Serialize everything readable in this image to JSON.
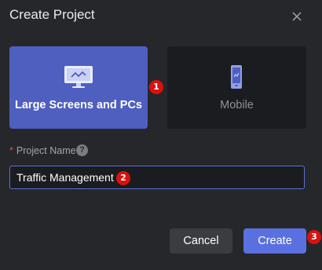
{
  "dialog": {
    "title": "Create Project",
    "close_icon": "close-icon"
  },
  "platform_options": [
    {
      "label": "Large Screens and PCs",
      "icon": "monitor-icon",
      "selected": true
    },
    {
      "label": "Mobile",
      "icon": "phone-icon",
      "selected": false
    }
  ],
  "form": {
    "required_mark": "*",
    "project_name_label": "Project Name",
    "help_icon": "question-circle-icon",
    "help_glyph": "?",
    "project_name_value": "Traffic Management"
  },
  "buttons": {
    "cancel_label": "Cancel",
    "create_label": "Create"
  },
  "step_badges": [
    "1",
    "2",
    "3"
  ],
  "colors": {
    "background": "#26272b",
    "selected_card": "#4f5fc0",
    "unselected_card": "#1b1c1f",
    "primary_button": "#5b70e0",
    "badge": "#d9120f"
  }
}
